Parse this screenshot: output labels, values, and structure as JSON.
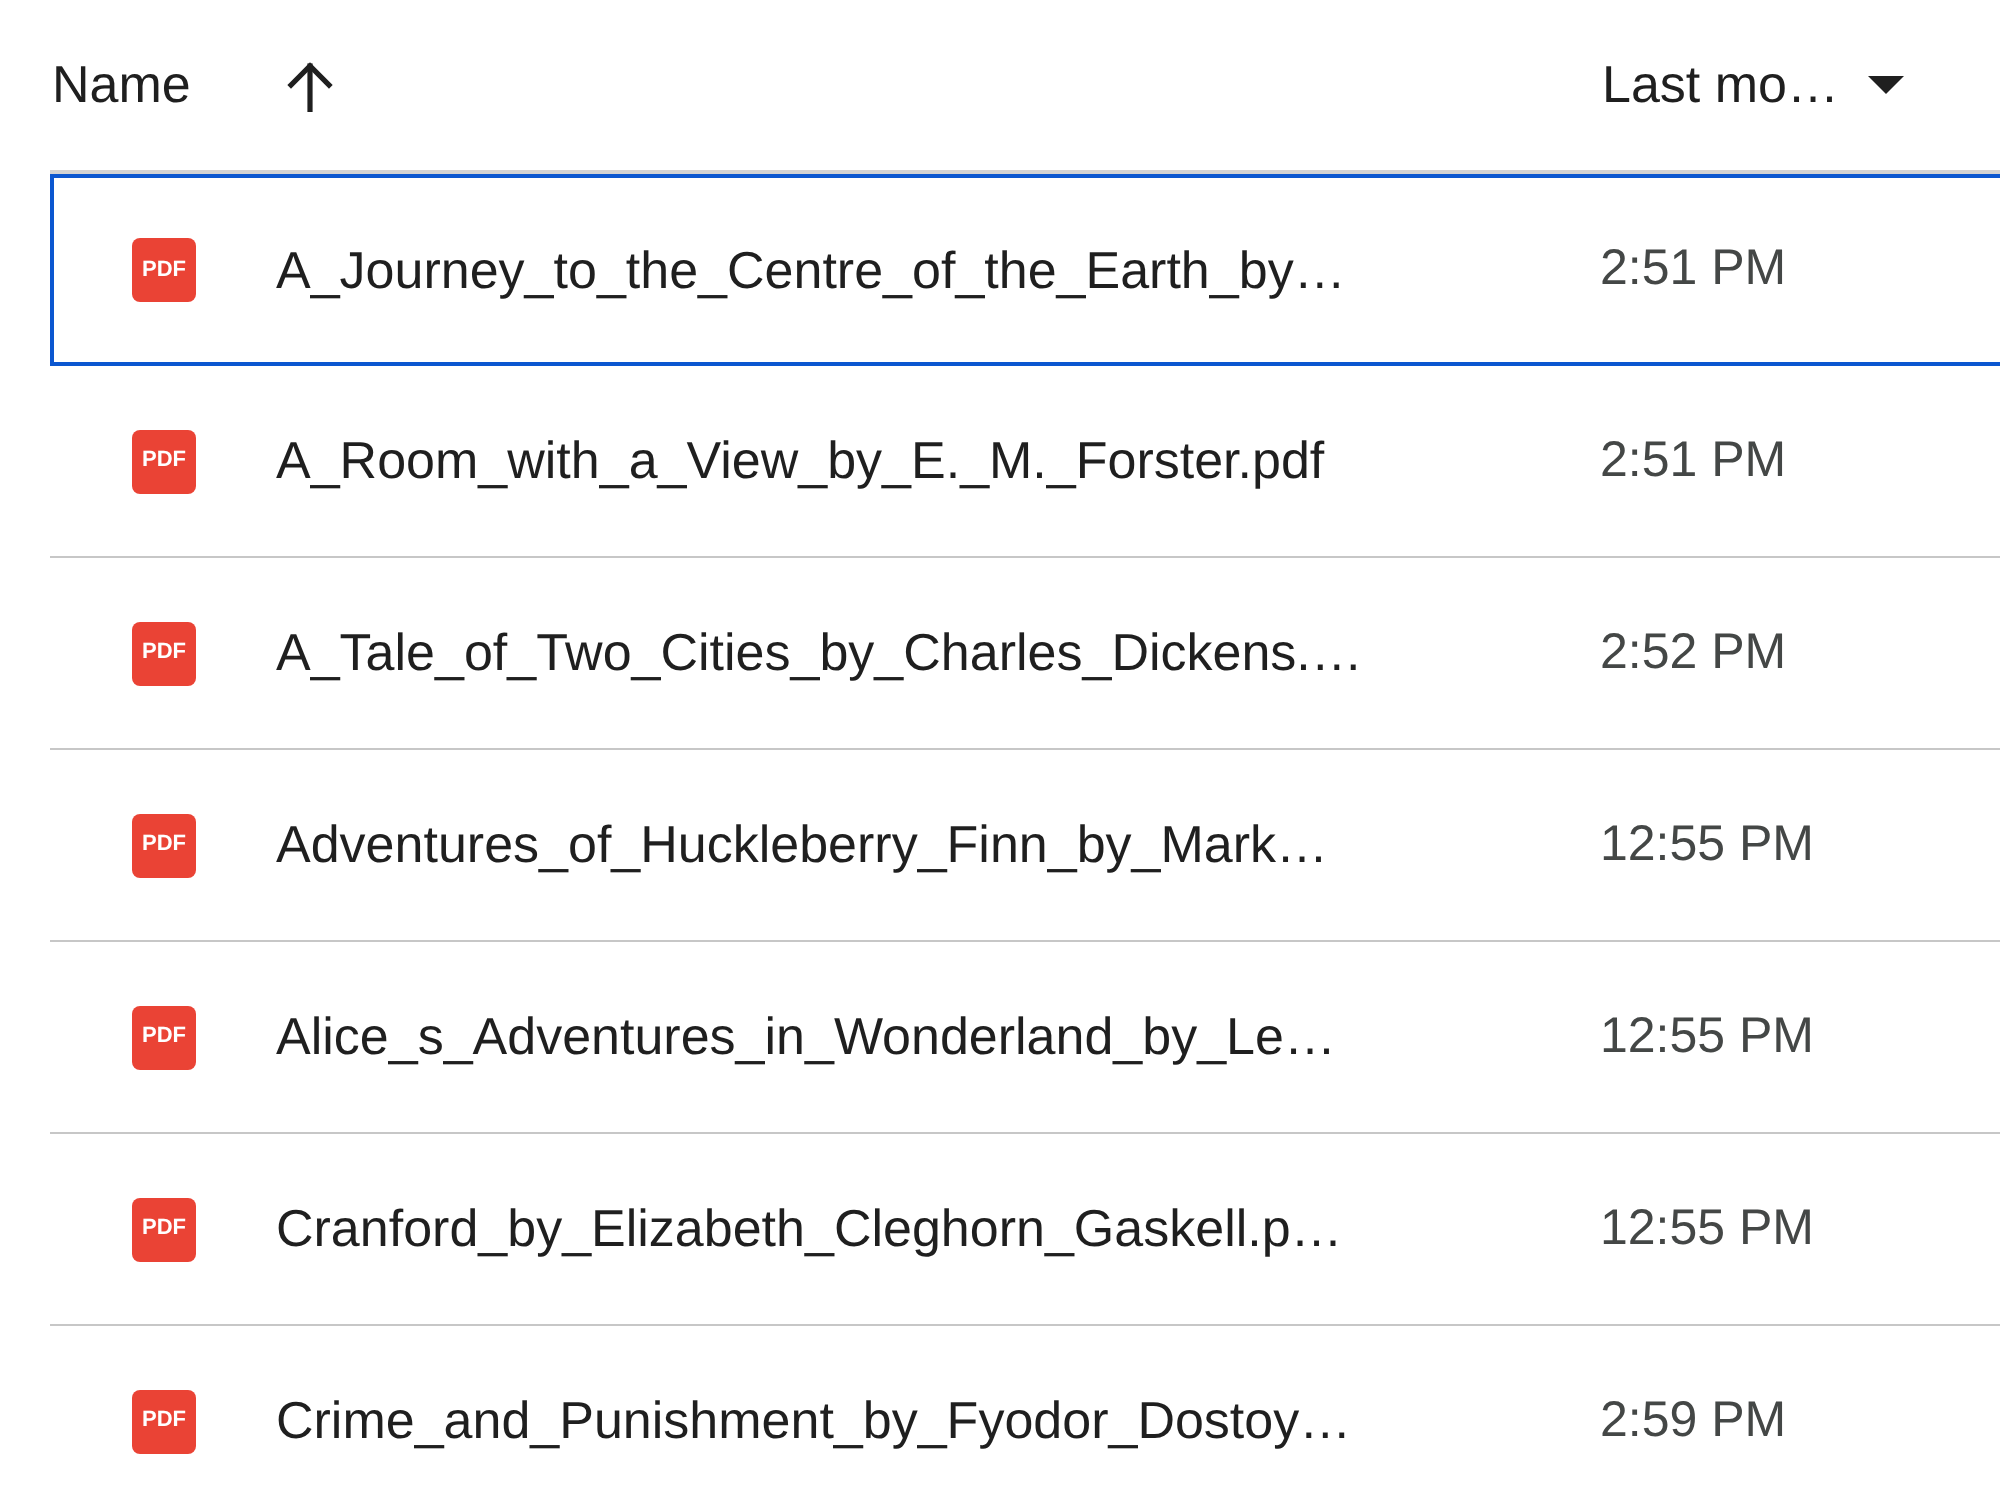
{
  "header": {
    "columns": [
      {
        "label": "Name",
        "sort_ascending": true
      },
      {
        "label": "Last mo…",
        "dropdown": true
      }
    ]
  },
  "rows": [
    {
      "icon_label": "PDF",
      "name": "A_Journey_to_the_Centre_of_the_Earth_by…",
      "modified": "2:51 PM",
      "selected": true
    },
    {
      "icon_label": "PDF",
      "name": "A_Room_with_a_View_by_E._M._Forster.pdf",
      "modified": "2:51 PM",
      "selected": false
    },
    {
      "icon_label": "PDF",
      "name": "A_Tale_of_Two_Cities_by_Charles_Dickens.…",
      "modified": "2:52 PM",
      "selected": false
    },
    {
      "icon_label": "PDF",
      "name": "Adventures_of_Huckleberry_Finn_by_Mark…",
      "modified": "12:55 PM",
      "selected": false
    },
    {
      "icon_label": "PDF",
      "name": "Alice_s_Adventures_in_Wonderland_by_Le…",
      "modified": "12:55 PM",
      "selected": false
    },
    {
      "icon_label": "PDF",
      "name": "Cranford_by_Elizabeth_Cleghorn_Gaskell.p…",
      "modified": "12:55 PM",
      "selected": false
    },
    {
      "icon_label": "PDF",
      "name": "Crime_and_Punishment_by_Fyodor_Dostoy…",
      "modified": "2:59 PM",
      "selected": false
    }
  ]
}
